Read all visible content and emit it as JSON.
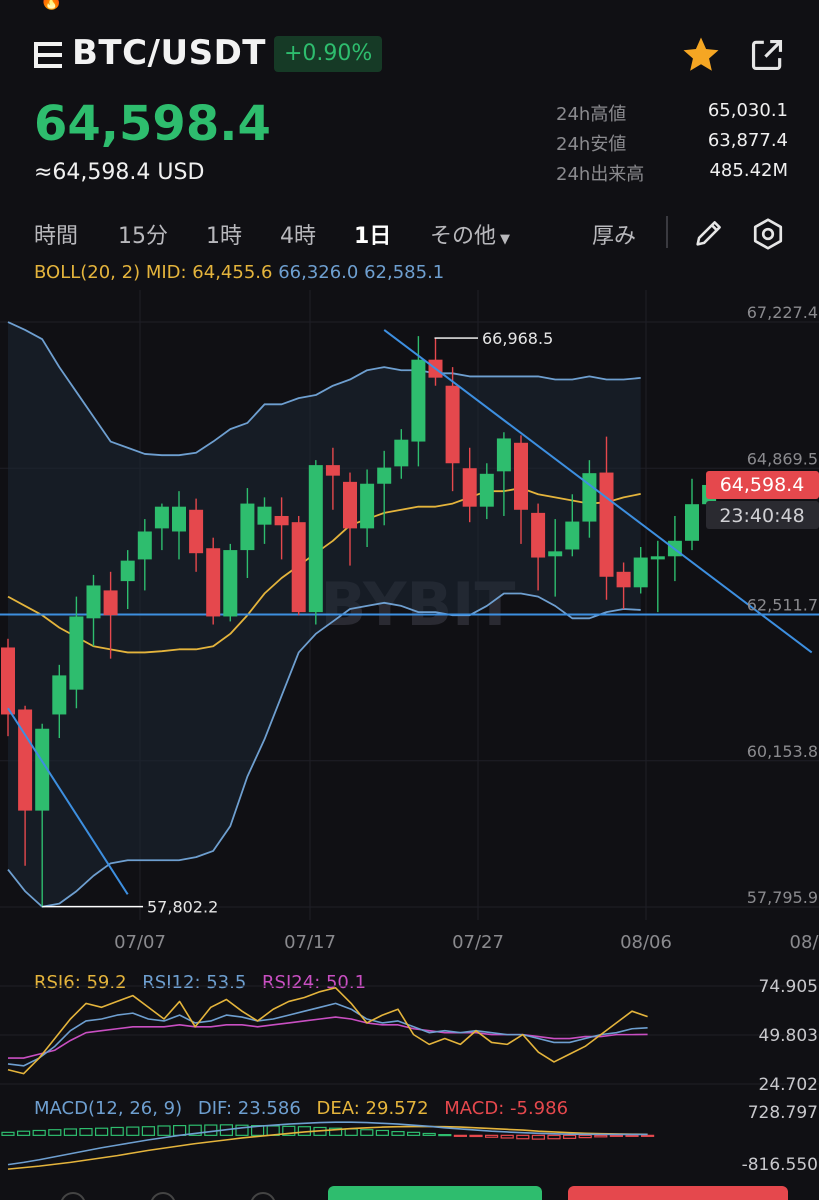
{
  "header": {
    "pair": "BTC/USDT",
    "change": "+0.90%",
    "price": "64,598.4",
    "price_usd": "≈64,598.4 USD"
  },
  "stats": [
    {
      "label": "24h高値",
      "value": "65,030.1"
    },
    {
      "label": "24h安値",
      "value": "63,877.4"
    },
    {
      "label": "24h出来高",
      "value": "485.42M"
    }
  ],
  "tabs": [
    "時間",
    "15分",
    "1時",
    "4時",
    "1日",
    "その他",
    "厚み"
  ],
  "active_tab": "1日",
  "boll": {
    "label": "BOLL(20, 2) MID: 64,455.6",
    "upper_lower": "66,326.0 62,585.1"
  },
  "main_chart": {
    "y_labels": [
      "67,227.4",
      "64,869.5",
      "62,511.7",
      "60,153.8",
      "57,795.9"
    ],
    "x_labels": [
      "07/07",
      "07/17",
      "07/27",
      "08/06",
      "08/"
    ],
    "high_marker": "66,968.5",
    "low_marker": "57,802.2",
    "current_price_tag": "64,598.4",
    "countdown_tag": "23:40:48",
    "watermark": "BYBIT"
  },
  "chart_data": {
    "type": "candlestick",
    "ylim": [
      57795.9,
      67227.4
    ],
    "candles": [
      [
        61980,
        62120,
        60550,
        60900
      ],
      [
        60980,
        61040,
        58460,
        59350
      ],
      [
        59350,
        60750,
        57802,
        60670
      ],
      [
        60900,
        61700,
        60520,
        61530
      ],
      [
        61300,
        62800,
        61000,
        62480
      ],
      [
        62450,
        63150,
        62000,
        62980
      ],
      [
        62900,
        63200,
        61800,
        62500
      ],
      [
        63050,
        63550,
        62600,
        63380
      ],
      [
        63400,
        64050,
        62900,
        63850
      ],
      [
        63900,
        64300,
        63550,
        64250
      ],
      [
        63850,
        64500,
        63400,
        64250
      ],
      [
        64200,
        64380,
        63200,
        63500
      ],
      [
        63580,
        63750,
        62350,
        62480
      ],
      [
        62480,
        63650,
        62400,
        63550
      ],
      [
        63550,
        64550,
        63100,
        64300
      ],
      [
        63960,
        64400,
        63650,
        64250
      ],
      [
        64100,
        64400,
        63400,
        63950
      ],
      [
        64000,
        64100,
        62500,
        62550
      ],
      [
        62550,
        65000,
        62350,
        64920
      ],
      [
        64920,
        65200,
        64200,
        64750
      ],
      [
        64650,
        64800,
        63300,
        63900
      ],
      [
        63900,
        64850,
        63600,
        64620
      ],
      [
        64620,
        65150,
        63950,
        64880
      ],
      [
        64900,
        65500,
        64700,
        65330
      ],
      [
        65300,
        67000,
        64900,
        66620
      ],
      [
        66620,
        66968.5,
        66200,
        66330
      ],
      [
        66200,
        66500,
        64500,
        64950
      ],
      [
        64870,
        65200,
        64000,
        64250
      ],
      [
        64250,
        64950,
        64050,
        64780
      ],
      [
        64820,
        65450,
        64100,
        65350
      ],
      [
        65280,
        65400,
        63650,
        64200
      ],
      [
        64150,
        64300,
        62900,
        63430
      ],
      [
        63450,
        64050,
        62800,
        63530
      ],
      [
        63560,
        64450,
        63450,
        64010
      ],
      [
        64010,
        65000,
        63750,
        64790
      ],
      [
        64800,
        65380,
        62750,
        63120
      ],
      [
        63200,
        63350,
        62600,
        62950
      ],
      [
        62950,
        63600,
        62850,
        63430
      ],
      [
        63400,
        63700,
        62550,
        63450
      ],
      [
        63450,
        64100,
        63050,
        63700
      ],
      [
        63700,
        64700,
        63550,
        64290
      ],
      [
        64290,
        64680,
        64100,
        64600
      ]
    ],
    "boll_upper": [
      67227,
      67100,
      66950,
      66500,
      66100,
      65700,
      65300,
      65200,
      65100,
      65080,
      65080,
      65120,
      65300,
      65500,
      65600,
      65900,
      65900,
      66000,
      66050,
      66200,
      66300,
      66450,
      66500,
      66450,
      66450,
      66400,
      66400,
      66350,
      66350,
      66350,
      66350,
      66350,
      66300,
      66300,
      66350,
      66300,
      66300,
      66326
    ],
    "boll_mid": [
      62800,
      62650,
      62500,
      62300,
      62150,
      62000,
      61950,
      61900,
      61900,
      61920,
      61950,
      61950,
      62000,
      62200,
      62500,
      62850,
      63100,
      63300,
      63500,
      63700,
      63950,
      64050,
      64150,
      64200,
      64250,
      64250,
      64300,
      64400,
      64500,
      64500,
      64550,
      64450,
      64400,
      64350,
      64300,
      64320,
      64400,
      64455.6
    ],
    "boll_lower": [
      58400,
      58050,
      57800,
      57850,
      58050,
      58300,
      58500,
      58550,
      58550,
      58550,
      58550,
      58600,
      58700,
      59100,
      59900,
      60500,
      61200,
      61900,
      62200,
      62400,
      62600,
      62650,
      62700,
      62650,
      62550,
      62550,
      62500,
      62500,
      62650,
      62850,
      62850,
      62800,
      62650,
      62450,
      62450,
      62550,
      62600,
      62585.1
    ],
    "trendlines": [
      {
        "from": [
          0,
          61000
        ],
        "to": [
          7,
          58000
        ]
      },
      {
        "from": [
          22,
          67100
        ],
        "to": [
          47,
          61900
        ]
      }
    ],
    "hline": 62511.7
  },
  "rsi": {
    "legend": [
      {
        "text": "RSI6: 59.2",
        "color": "#e4b43c"
      },
      {
        "text": "RSI12: 53.5",
        "color": "#6e9fd0"
      },
      {
        "text": "RSI24: 50.1",
        "color": "#c94fc2"
      }
    ],
    "y_labels": [
      "74.905",
      "49.803",
      "24.702"
    ],
    "ylim": [
      24.702,
      74.905
    ],
    "rsi6": [
      32,
      30,
      38,
      48,
      58,
      66,
      64,
      67,
      70,
      64,
      58,
      67,
      54,
      64,
      68,
      62,
      57,
      63,
      67,
      69,
      72,
      74,
      66,
      56,
      60,
      63,
      50,
      45,
      48,
      45,
      52,
      46,
      45,
      50,
      41,
      36,
      40,
      44,
      50,
      56,
      62,
      59.2
    ],
    "rsi12": [
      35,
      34,
      38,
      44,
      52,
      57,
      58,
      60,
      61,
      58,
      57,
      60,
      56,
      57,
      60,
      59,
      57,
      58,
      60,
      62,
      64,
      66,
      63,
      58,
      56,
      57,
      54,
      51,
      52,
      51,
      52,
      51,
      50,
      50,
      48,
      46,
      46,
      48,
      50,
      51,
      53,
      53.5
    ],
    "rsi24": [
      38,
      38,
      40,
      42,
      47,
      51,
      52,
      53,
      54,
      54,
      54,
      55,
      54,
      54,
      55,
      55,
      54,
      55,
      56,
      57,
      58,
      59,
      58,
      56,
      55,
      55,
      53,
      52,
      51,
      51,
      51,
      50,
      50,
      50,
      49,
      48,
      48,
      49,
      49,
      50,
      50,
      50.1
    ]
  },
  "macd": {
    "legend": [
      {
        "text": "MACD(12, 26, 9)",
        "color": "#6e9fd0"
      },
      {
        "text": "DIF: 23.586",
        "color": "#6e9fd0"
      },
      {
        "text": "DEA: 29.572",
        "color": "#e4b43c"
      },
      {
        "text": "MACD: -5.986",
        "color": "#e5484d"
      }
    ],
    "y_labels": [
      "728.797",
      "-816.550"
    ],
    "ylim": [
      -816.55,
      728.797
    ],
    "hist": [
      80,
      110,
      130,
      150,
      170,
      180,
      190,
      210,
      220,
      230,
      250,
      260,
      270,
      275,
      280,
      270,
      260,
      250,
      240,
      230,
      210,
      190,
      170,
      150,
      130,
      100,
      80,
      50,
      20,
      -10,
      -30,
      -50,
      -70,
      -90,
      -100,
      -90,
      -80,
      -60,
      -40,
      -25,
      -15,
      -6
    ],
    "dif": [
      -780,
      -720,
      -650,
      -570,
      -490,
      -410,
      -330,
      -260,
      -190,
      -120,
      -60,
      0,
      50,
      100,
      150,
      200,
      240,
      270,
      300,
      320,
      340,
      350,
      350,
      340,
      320,
      300,
      270,
      240,
      200,
      170,
      140,
      110,
      90,
      70,
      55,
      40,
      32,
      28,
      26,
      24,
      23.6,
      23.6
    ],
    "dea": [
      -900,
      -860,
      -820,
      -770,
      -720,
      -660,
      -600,
      -540,
      -470,
      -400,
      -340,
      -280,
      -220,
      -170,
      -120,
      -70,
      -30,
      10,
      50,
      90,
      120,
      150,
      180,
      200,
      220,
      230,
      235,
      235,
      230,
      220,
      200,
      180,
      160,
      140,
      110,
      90,
      70,
      55,
      45,
      38,
      32,
      29.6
    ]
  },
  "colors": {
    "up": "#2ebd6e",
    "down": "#e5484d",
    "boll_mid": "#e4b43c",
    "boll_band": "#6e9fd0",
    "trendline": "#3d8fe0",
    "grid": "#1f1f26"
  }
}
